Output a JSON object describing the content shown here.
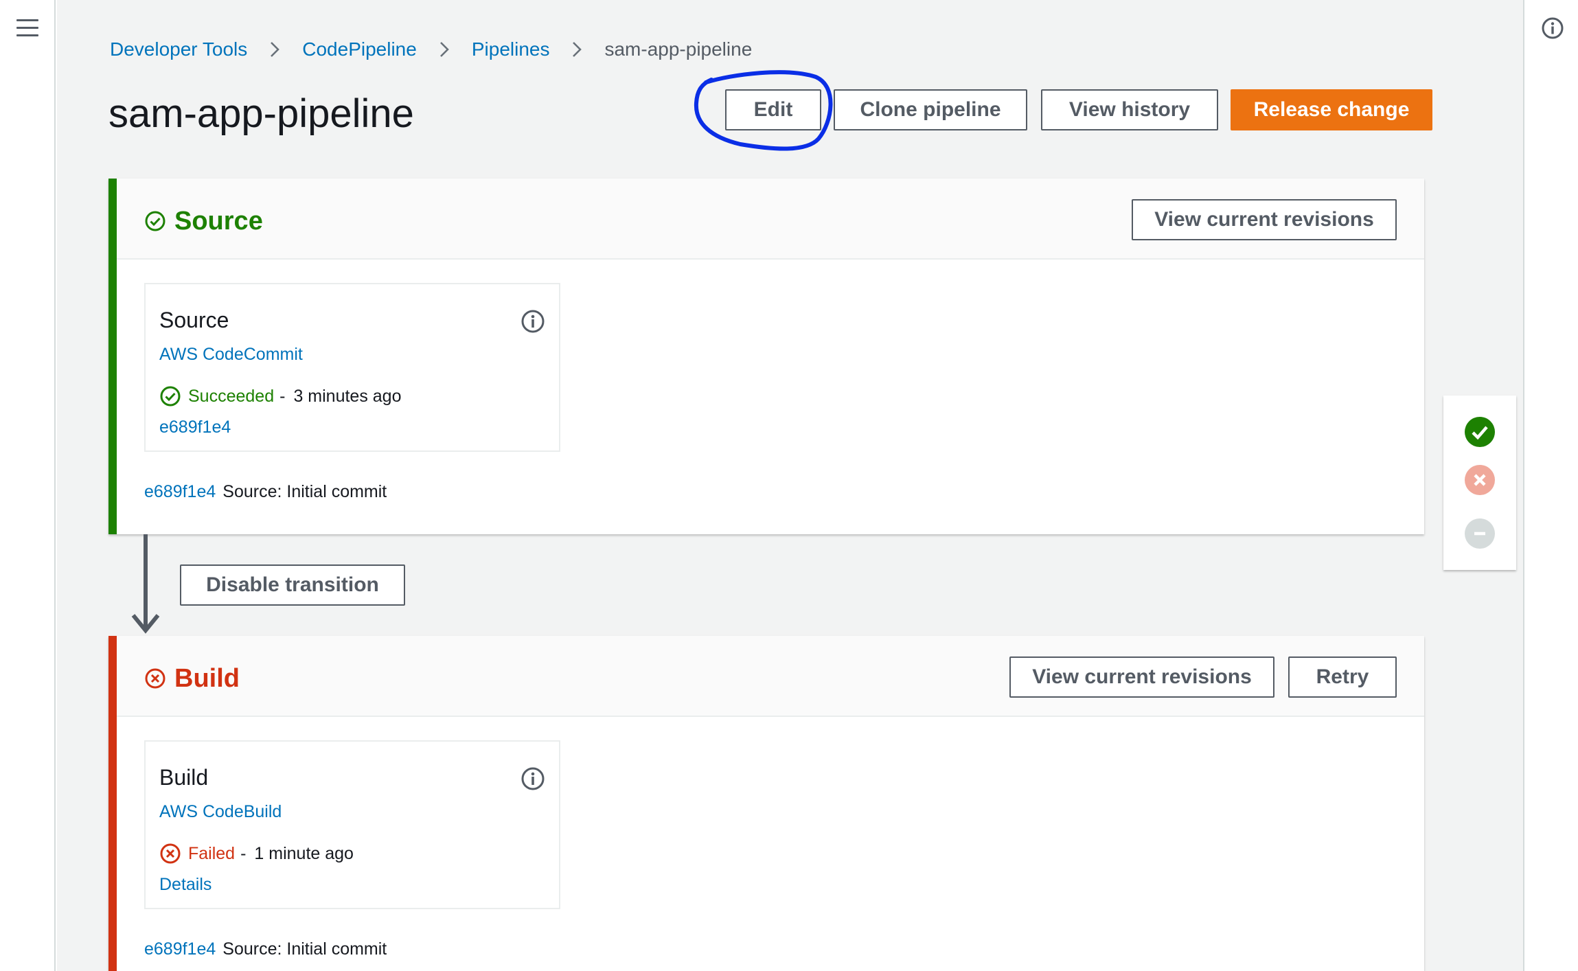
{
  "nav": {
    "menu_icon": "hamburger-menu-icon",
    "info_icon": "info-icon"
  },
  "breadcrumb": {
    "items": [
      "Developer Tools",
      "CodePipeline",
      "Pipelines"
    ],
    "current": "sam-app-pipeline",
    "separator_icon": "chevron-right-icon"
  },
  "header": {
    "title": "sam-app-pipeline",
    "buttons": {
      "edit": "Edit",
      "clone": "Clone pipeline",
      "history": "View history",
      "release": "Release change"
    }
  },
  "stages": [
    {
      "name": "Source",
      "status": "succeeded",
      "view_revisions_label": "View current revisions",
      "action": {
        "title": "Source",
        "provider": "AWS CodeCommit",
        "status_label": "Succeeded",
        "status_time": "3 minutes ago",
        "link": "e689f1e4"
      },
      "commit": {
        "id": "e689f1e4",
        "message": "Source: Initial commit"
      }
    },
    {
      "name": "Build",
      "status": "failed",
      "view_revisions_label": "View current revisions",
      "retry_label": "Retry",
      "action": {
        "title": "Build",
        "provider": "AWS CodeBuild",
        "status_label": "Failed",
        "status_time": "1 minute ago",
        "link": "Details"
      },
      "commit": {
        "id": "e689f1e4",
        "message": "Source: Initial commit"
      }
    }
  ],
  "transition": {
    "disable_label": "Disable transition"
  },
  "side_panel": {
    "icons": [
      "success-check-icon",
      "failed-x-icon",
      "disabled-minus-icon"
    ]
  },
  "colors": {
    "success": "#1d8102",
    "failed": "#d13212",
    "primary": "#ec7211",
    "link": "#0073bb",
    "annotation": "#0a2ee6"
  }
}
